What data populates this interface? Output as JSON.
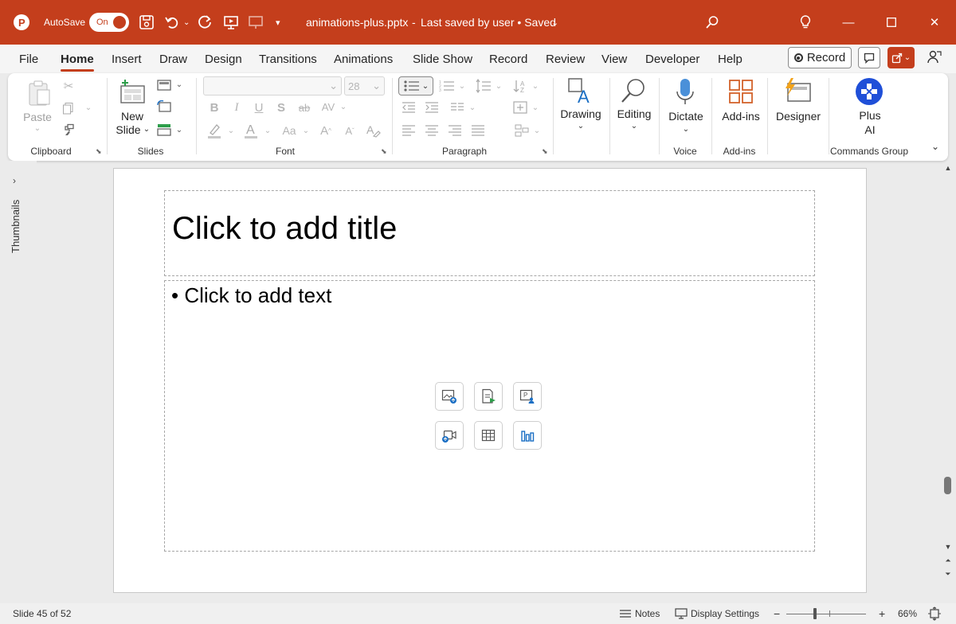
{
  "titlebar": {
    "autosave_label": "AutoSave",
    "autosave_state": "On",
    "filename": "animations-plus.pptx",
    "save_status": "Last saved by user • Saved",
    "accent": "#c43e1c"
  },
  "menu": {
    "tabs": [
      "File",
      "Home",
      "Insert",
      "Draw",
      "Design",
      "Transitions",
      "Animations",
      "Slide Show",
      "Record",
      "Review",
      "View",
      "Developer",
      "Help"
    ],
    "active": "Home",
    "record_label": "Record"
  },
  "ribbon": {
    "clipboard": {
      "label": "Clipboard",
      "paste": "Paste"
    },
    "slides": {
      "label": "Slides",
      "new_slide": "New",
      "new_slide_2": "Slide"
    },
    "font": {
      "label": "Font",
      "size": "28"
    },
    "paragraph": {
      "label": "Paragraph"
    },
    "drawing": {
      "label": "Drawing"
    },
    "editing": {
      "label": "Editing"
    },
    "voice": {
      "label": "Voice",
      "dictate": "Dictate"
    },
    "addins": {
      "label": "Add-ins",
      "button": "Add-ins"
    },
    "designer": {
      "button": "Designer"
    },
    "commands": {
      "label": "Commands Group",
      "plus_1": "Plus",
      "plus_2": "AI"
    }
  },
  "rail": {
    "label": "Thumbnails"
  },
  "slide": {
    "title_placeholder": "Click to add title",
    "body_placeholder": "Click to add text",
    "bullet": "•"
  },
  "status": {
    "slide_counter": "Slide 45 of 52",
    "notes": "Notes",
    "display_settings": "Display Settings",
    "zoom_minus": "−",
    "zoom_plus": "+",
    "zoom_level": "66%"
  }
}
